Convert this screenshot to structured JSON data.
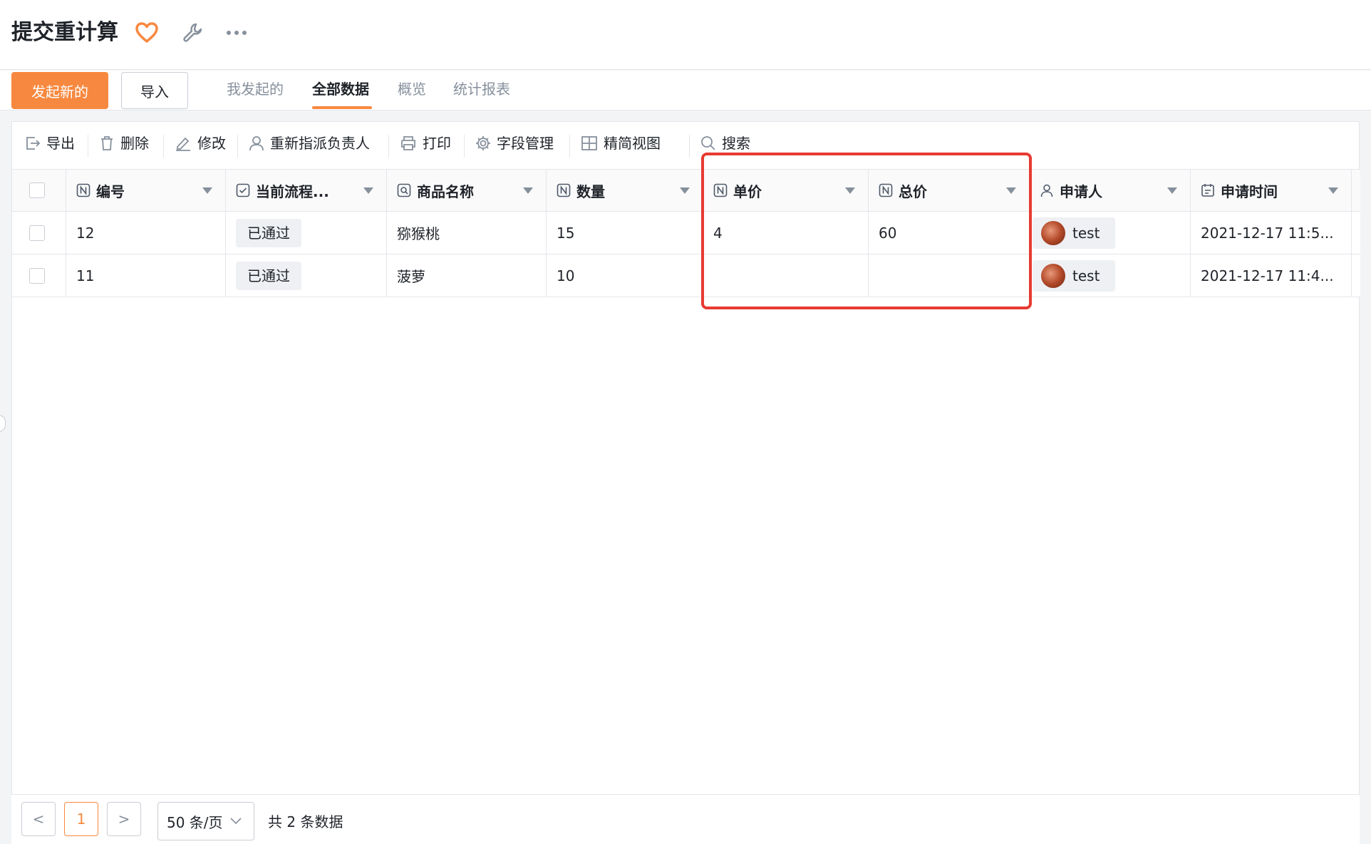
{
  "header": {
    "title": "提交重计算"
  },
  "tabbar": {
    "new_button": "发起新的",
    "import_button": "导入",
    "tabs": [
      {
        "label": "我发起的"
      },
      {
        "label": "全部数据"
      },
      {
        "label": "概览"
      },
      {
        "label": "统计报表"
      }
    ],
    "active_tab": "全部数据"
  },
  "toolbar": {
    "items": [
      {
        "label": "导出"
      },
      {
        "label": "删除"
      },
      {
        "label": "修改"
      },
      {
        "label": "重新指派负责人"
      },
      {
        "label": "打印"
      },
      {
        "label": "字段管理"
      },
      {
        "label": "精简视图"
      },
      {
        "label": "搜索"
      }
    ]
  },
  "table": {
    "columns": [
      {
        "label": "编号"
      },
      {
        "label": "当前流程..."
      },
      {
        "label": "商品名称"
      },
      {
        "label": "数量"
      },
      {
        "label": "单价"
      },
      {
        "label": "总价"
      },
      {
        "label": "申请人"
      },
      {
        "label": "申请时间"
      }
    ],
    "rows": [
      {
        "id": "12",
        "status": "已通过",
        "product": "猕猴桃",
        "qty": "15",
        "unit_price": "4",
        "total": "60",
        "applicant": "test",
        "time": "2021-12-17 11:5..."
      },
      {
        "id": "11",
        "status": "已通过",
        "product": "菠萝",
        "qty": "10",
        "unit_price": "",
        "total": "",
        "applicant": "test",
        "time": "2021-12-17 11:4..."
      }
    ]
  },
  "pagination": {
    "prev": "<",
    "current_page": "1",
    "next": ">",
    "page_size": "50 条/页",
    "total": "共 2 条数据"
  },
  "colors": {
    "accent": "#f7883f",
    "highlight": "#e83a32"
  }
}
